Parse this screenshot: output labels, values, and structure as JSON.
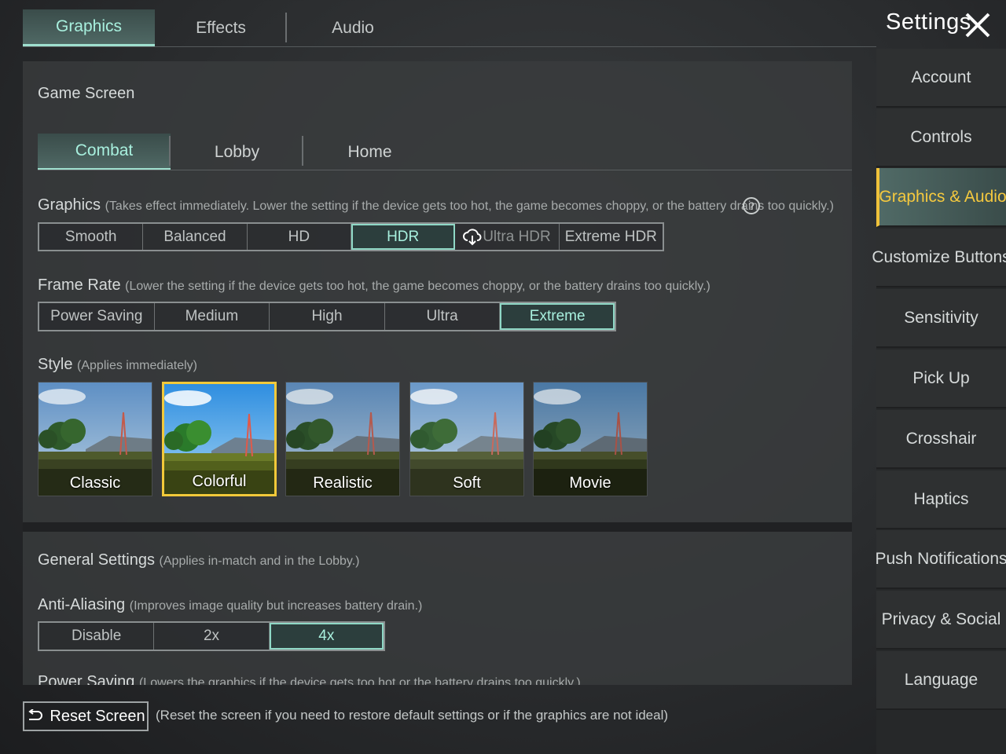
{
  "top_tabs": [
    {
      "label": "Graphics",
      "active": true
    },
    {
      "label": "Effects",
      "active": false
    },
    {
      "label": "Audio",
      "active": false
    }
  ],
  "header": {
    "title": "Settings"
  },
  "sidebar": {
    "items": [
      {
        "label": "Account"
      },
      {
        "label": "Controls"
      },
      {
        "label": "Graphics & Audio",
        "active": true
      },
      {
        "label": "Customize Buttons"
      },
      {
        "label": "Sensitivity"
      },
      {
        "label": "Pick Up"
      },
      {
        "label": "Crosshair"
      },
      {
        "label": "Haptics"
      },
      {
        "label": "Push Notifications"
      },
      {
        "label": "Privacy & Social"
      },
      {
        "label": "Language"
      }
    ]
  },
  "game_screen": {
    "title": "Game Screen",
    "sub_tabs": [
      {
        "label": "Combat",
        "active": true
      },
      {
        "label": "Lobby"
      },
      {
        "label": "Home"
      }
    ]
  },
  "graphics": {
    "label": "Graphics",
    "note": "(Takes effect immediately. Lower the setting if the device gets too hot, the game becomes choppy, or the battery drains too quickly.)",
    "options": [
      "Smooth",
      "Balanced",
      "HD",
      "HDR",
      "Ultra HDR",
      "Extreme HDR"
    ],
    "selected": "HDR"
  },
  "frame_rate": {
    "label": "Frame Rate",
    "note": "(Lower the setting if the device gets too hot, the game becomes choppy, or the battery drains too quickly.)",
    "options": [
      "Power Saving",
      "Medium",
      "High",
      "Ultra",
      "Extreme"
    ],
    "selected": "Extreme"
  },
  "style": {
    "label": "Style",
    "note": "(Applies immediately)",
    "options": [
      "Classic",
      "Colorful",
      "Realistic",
      "Soft",
      "Movie"
    ],
    "selected": "Colorful"
  },
  "general": {
    "label": "General Settings",
    "note": "(Applies in-match and in the Lobby.)"
  },
  "anti_aliasing": {
    "label": "Anti-Aliasing",
    "note": "(Improves image quality but increases battery drain.)",
    "options": [
      "Disable",
      "2x",
      "4x"
    ],
    "selected": "4x"
  },
  "power_saving": {
    "label": "Power Saving",
    "note": "(Lowers the graphics if the device gets too hot or the battery drains too quickly.)"
  },
  "footer": {
    "reset_label": "Reset Screen",
    "reset_note": "(Reset the screen if you need to restore default settings or if the graphics are not ideal)"
  },
  "colors": {
    "accent": "#a8f0de",
    "selected_gold": "#f2c93a"
  },
  "icons": {
    "close": "close-icon",
    "help": "help-icon",
    "cloud_download": "cloud-download-icon",
    "reset": "undo-icon"
  }
}
